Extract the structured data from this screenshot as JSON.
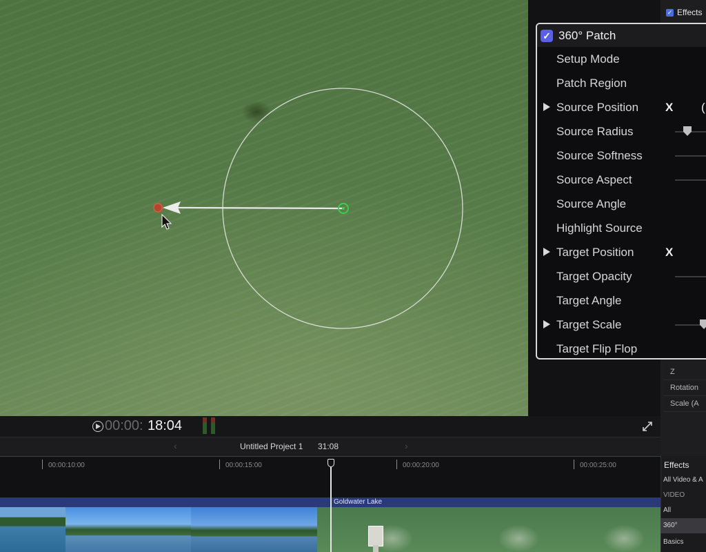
{
  "inspector": {
    "effects_tab_label": "Effects",
    "effect": {
      "name": "360° Patch",
      "enabled": true,
      "params": [
        {
          "label": "Setup Mode"
        },
        {
          "label": "Patch Region"
        },
        {
          "label": "Source Position",
          "expandable": true,
          "sub": "X",
          "extra": "("
        },
        {
          "label": "Source Radius",
          "slider": 0.3
        },
        {
          "label": "Source Softness",
          "slider": null
        },
        {
          "label": "Source Aspect",
          "slider": null
        },
        {
          "label": "Source Angle"
        },
        {
          "label": "Highlight Source"
        },
        {
          "label": "Target Position",
          "expandable": true,
          "sub": "X"
        },
        {
          "label": "Target Opacity",
          "slider": null
        },
        {
          "label": "Target Angle"
        },
        {
          "label": "Target Scale",
          "expandable": true,
          "slider": 0.7
        },
        {
          "label": "Target Flip Flop"
        }
      ]
    },
    "list_rows": [
      "Z",
      "Rotation",
      "Scale (A"
    ]
  },
  "viewer": {
    "timecode_dim": "00:00:",
    "timecode_bright": "18:04"
  },
  "timeline": {
    "project_name": "Untitled Project 1",
    "duration": "31:08",
    "prev_arrow": "‹",
    "next_arrow": "›",
    "ruler": [
      "00:00:10:00",
      "00:00:15:00",
      "00:00:20:00",
      "00:00:25:00"
    ],
    "clip_name": "Goldwater Lake"
  },
  "effects_browser": {
    "title": "Effects",
    "items": [
      {
        "label": "All Video & A",
        "type": "item"
      },
      {
        "label": "VIDEO",
        "type": "section"
      },
      {
        "label": "All",
        "type": "item"
      },
      {
        "label": "360°",
        "type": "selected"
      },
      {
        "label": "Basics",
        "type": "item"
      }
    ]
  },
  "colors": {
    "accent_checkbox": "#5a5fe8",
    "clip_bar": "#2a3a78",
    "source_handle": "#c0392b",
    "target_handle": "#2ecc40"
  }
}
